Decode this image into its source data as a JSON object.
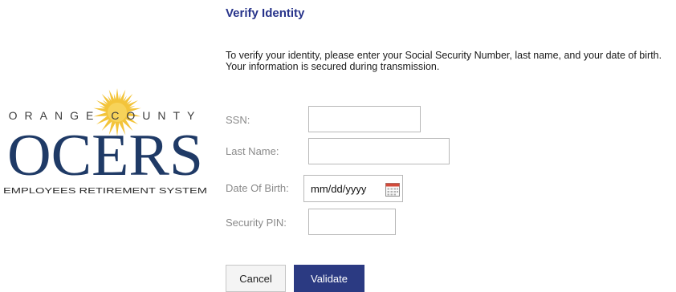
{
  "logo": {
    "top_text": "ORANGE COUNTY",
    "mark_text": "OCERS",
    "bottom_text": "EMPLOYEES RETIREMENT SYSTEM"
  },
  "heading": "Verify Identity",
  "intro": "To verify your identity, please enter your Social Security Number, last name, and your date of birth. Your information is secured during transmission.",
  "form": {
    "ssn_label": "SSN:",
    "ssn_value": "",
    "last_name_label": "Last Name:",
    "last_name_value": "",
    "dob_label": "Date Of Birth:",
    "dob_placeholder": "mm/dd/yyyy",
    "dob_value": "",
    "pin_label": "Security PIN:",
    "pin_value": "",
    "calendar_icon": "calendar-icon"
  },
  "buttons": {
    "cancel": "Cancel",
    "validate": "Validate"
  },
  "colors": {
    "heading": "#27338a",
    "primary_button": "#2b3a82",
    "logo_navy": "#1f3a66",
    "logo_sun": "#f3c43a"
  }
}
